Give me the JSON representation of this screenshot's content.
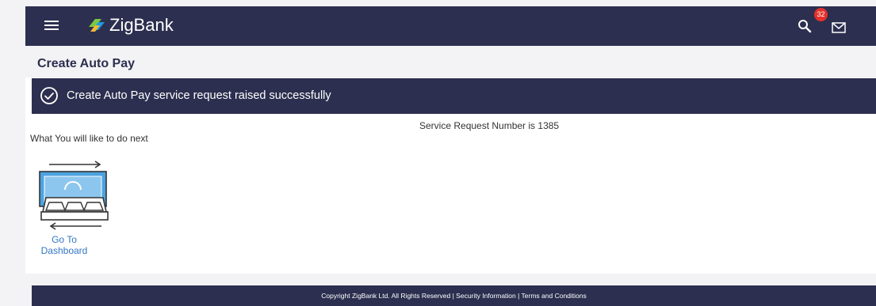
{
  "header": {
    "brand": "ZigBank",
    "icons": {
      "menu": "hamburger-menu-icon",
      "logo": "zigbank-logo-icon",
      "search": "search-icon",
      "mail": "mail-icon"
    },
    "mail_badge_count": "32",
    "colors": {
      "header_bg": "#2c2f4f",
      "badge": "#e4312b"
    }
  },
  "page": {
    "title": "Create Auto Pay"
  },
  "banner": {
    "icon": "check-circle-icon",
    "message": "Create Auto Pay service request raised successfully"
  },
  "result": {
    "service_request_text": "Service Request Number is 1385"
  },
  "next_actions": {
    "label": "What You will like to do next",
    "items": [
      {
        "icon": "dashboard-icon",
        "label_line1": "Go To",
        "label_line2": "Dashboard"
      }
    ]
  },
  "footer": {
    "text": "Copyright ZigBank Ltd. All Rights Reserved | Security Information | Terms and Conditions"
  },
  "colors": {
    "primary": "#2c2f4f",
    "link": "#3276c4",
    "page_bg": "#f3f3f5"
  }
}
